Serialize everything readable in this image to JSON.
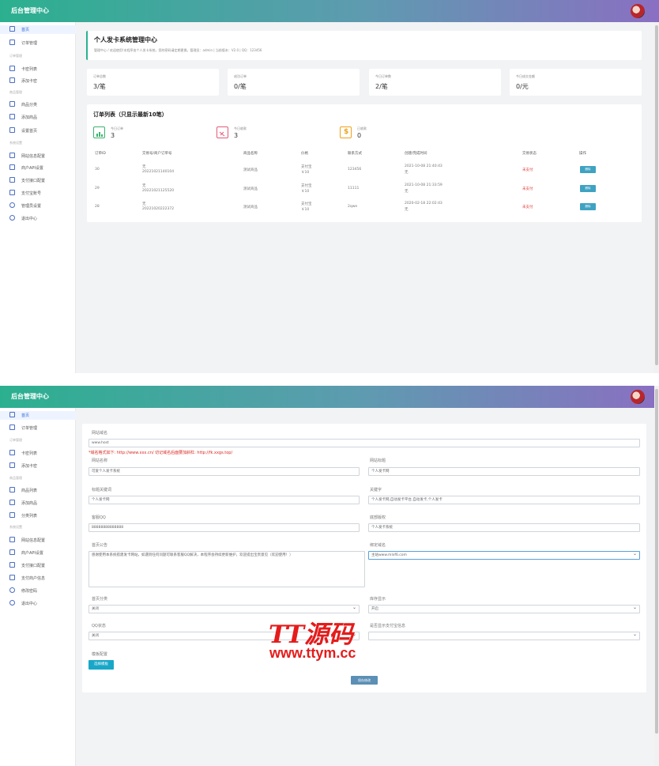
{
  "brand": "后台管理中心",
  "sidebar1": {
    "items": [
      {
        "label": "首页"
      },
      {
        "label": "订单管理"
      },
      {
        "label": "卡密列表"
      },
      {
        "label": "添加卡密"
      },
      {
        "label": "商品分类"
      },
      {
        "label": "添加商品"
      },
      {
        "label": "设置首页"
      },
      {
        "label": "网站信息配置"
      },
      {
        "label": "商户API设置"
      },
      {
        "label": "支付接口配置"
      },
      {
        "label": "支付宝账号"
      },
      {
        "label": "管理员设置"
      },
      {
        "label": "退出中心"
      }
    ],
    "heads": [
      "订单管理",
      "商品管理",
      "系统设置"
    ]
  },
  "sidebar2": {
    "items": [
      {
        "label": "首页"
      },
      {
        "label": "订单管理"
      },
      {
        "label": "卡密列表"
      },
      {
        "label": "添加卡密"
      },
      {
        "label": "商品列表"
      },
      {
        "label": "添加商品"
      },
      {
        "label": "分类列表"
      },
      {
        "label": "网站信息配置"
      },
      {
        "label": "商户API设置"
      },
      {
        "label": "支付接口配置"
      },
      {
        "label": "支付商户信息"
      },
      {
        "label": "修改密码"
      },
      {
        "label": "退出中心"
      }
    ],
    "heads": [
      "订单管理",
      "商品管理",
      "系统设置"
    ]
  },
  "welcome": {
    "title": "个人发卡系统管理中心",
    "subtitle": "管理中心 / 欢迎使用!本程序由个人发卡系统，您的密码请定期更换。管理员：admin | 当前版本：V2.0 | QQ：123456"
  },
  "stats": [
    {
      "label": "订单总数",
      "value": "3/笔"
    },
    {
      "label": "成功订单",
      "value": "0/笔"
    },
    {
      "label": "今日订单数",
      "value": "2/笔"
    },
    {
      "label": "今日成交金额",
      "value": "0/元"
    }
  ],
  "orders": {
    "title": "订单列表（只显示最新10笔）",
    "summary": [
      {
        "label": "今日订单",
        "value": "3",
        "icon": "chart-icon",
        "color": "#3cb371"
      },
      {
        "label": "今日收款",
        "value": "3",
        "icon": "card-icon",
        "color": "#e35b7a"
      },
      {
        "label": "已收款",
        "value": "0",
        "icon": "dollar-icon",
        "color": "#f0a21a"
      }
    ],
    "columns": [
      "订单ID",
      "交易号/商户订单号",
      "商品名称",
      "价格",
      "联系方式",
      "创建/完成时间",
      "交易状态",
      "操作"
    ],
    "rows": [
      {
        "id": "30",
        "trade_top": "无",
        "trade_no": "20221021140104",
        "name": "测试商品",
        "price_top": "支付宝",
        "price": "￥10",
        "contact": "123456",
        "time": "2021-10-08 21:40:43",
        "time2": "无",
        "status": "未支付",
        "action": "删除"
      },
      {
        "id": "29",
        "trade_top": "无",
        "trade_no": "20221021125520",
        "name": "测试商品",
        "price_top": "支付宝",
        "price": "￥10",
        "contact": "11111",
        "time": "2021-10-08 21:33:59",
        "time2": "无",
        "status": "未支付",
        "action": "删除"
      },
      {
        "id": "28",
        "trade_top": "无",
        "trade_no": "20221020222372",
        "name": "测试商品",
        "price_top": "支付宝",
        "price": "￥10",
        "contact": "2qwe",
        "time": "2020-02-18 22:02:43",
        "time2": "无",
        "status": "未支付",
        "action": "删除"
      }
    ]
  },
  "form": {
    "site_url_label": "网站域名",
    "site_url": "www.host",
    "warning": "*域名格式如下: http://www.xxx.cn/ 切记域名后面要加斜杠: http://fk.xxgs.top/",
    "site_name_label": "网站名称",
    "site_name": "可爱个人发卡系统",
    "site_title_label": "网站标题",
    "site_title": "个人发卡网",
    "keywords_label": "标题关键词",
    "keywords": "个人发卡网",
    "desc_label": "关键字",
    "desc": "个人发卡网,自动发卡平台,自动发卡,个人发卡",
    "qq_label": "客服QQ",
    "qq": "88888888888888",
    "footer_label": "底部版权",
    "footer": "个人发卡系统",
    "notice_label": "首页公告",
    "notice": "感谢使用本系统搭建发卡网站，如遇到任何问题可联系客服QQ解决，本程序会持续更新维护，欢迎提出宝贵意见（欢迎使用！）",
    "bind_label": "绑定域名",
    "bind": "主站www.mlxf6.com",
    "show_cat_label": "首页分类",
    "show_cat": "关闭",
    "show_stock_label": "库存显示",
    "show_stock": "开启",
    "qq_switch_label": "QQ状态",
    "qq_switch": "关闭",
    "pay_label": "是否显示支付宝信息",
    "pay": "",
    "template_label": "模板配置",
    "template_btn": "选择模板",
    "save_btn": "保存修改"
  },
  "watermark": {
    "line1": "TT源码",
    "line2": "www.ttym.cc"
  }
}
